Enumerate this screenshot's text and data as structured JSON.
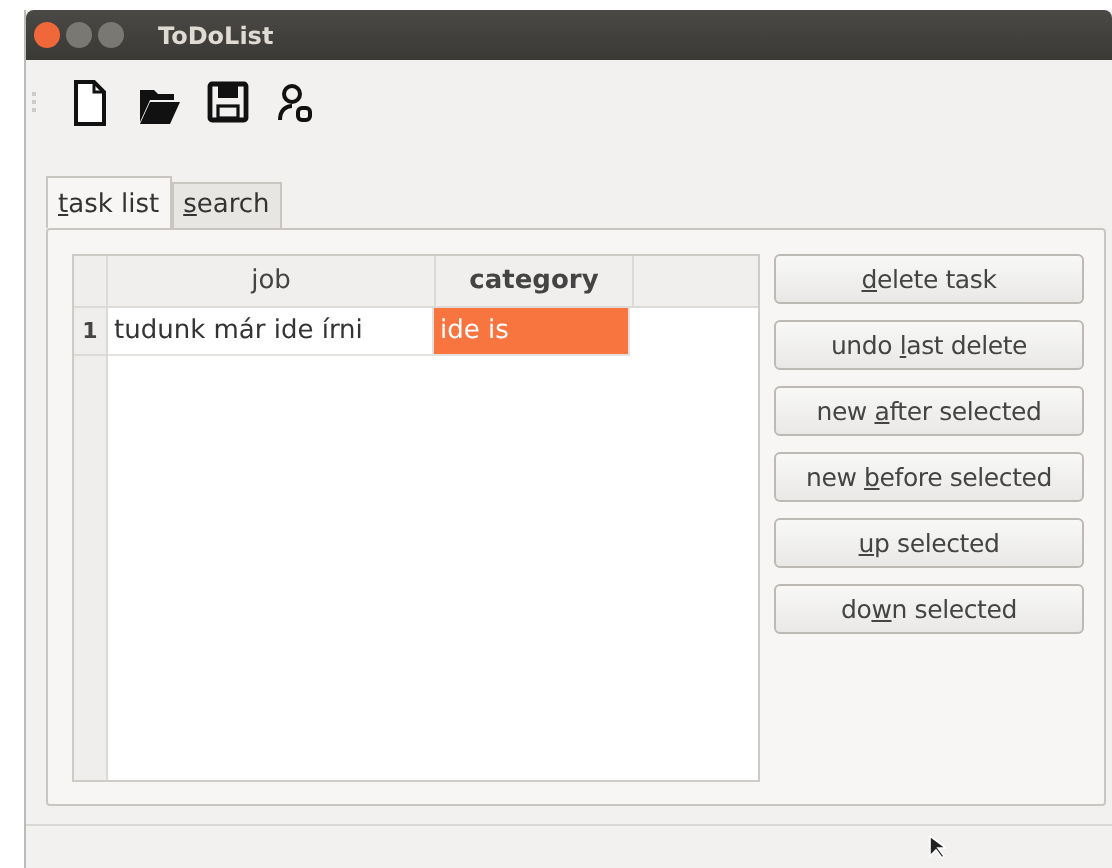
{
  "window": {
    "title": "ToDoList"
  },
  "toolbar": [
    {
      "kind": "new"
    },
    {
      "kind": "open"
    },
    {
      "kind": "save"
    },
    {
      "kind": "user"
    }
  ],
  "tabs": [
    {
      "key": "t",
      "after": "ask list",
      "selected": true
    },
    {
      "key": "s",
      "after": "earch",
      "selected": false
    }
  ],
  "table": {
    "columns": [
      {
        "label": "job",
        "current": false
      },
      {
        "label": "category",
        "current": true
      }
    ],
    "rows": [
      {
        "number": "1",
        "cells": [
          {
            "text": "tudunk már ide írni",
            "selected": false
          },
          {
            "text": "ide is",
            "selected": true
          }
        ]
      }
    ]
  },
  "buttons": [
    {
      "key": "d",
      "after": "elete task"
    },
    {
      "before": "undo ",
      "key": "l",
      "after": "ast delete"
    },
    {
      "before": "new ",
      "key": "a",
      "after": "fter selected"
    },
    {
      "before": "new ",
      "key": "b",
      "after": "efore selected"
    },
    {
      "key": "u",
      "after": "p selected"
    },
    {
      "before": "do",
      "key": "w",
      "after": "n selected"
    }
  ]
}
